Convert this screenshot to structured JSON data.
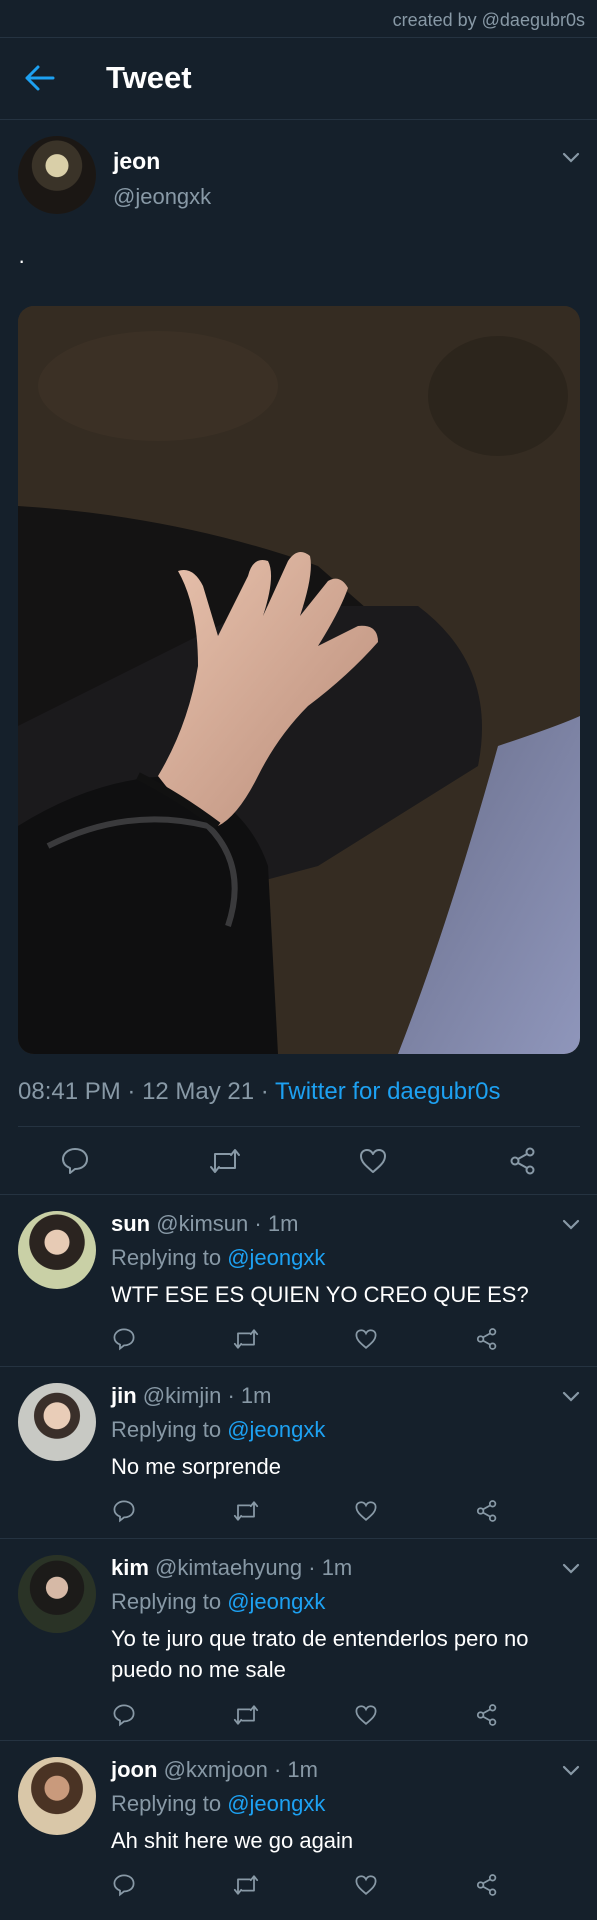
{
  "credit": "created by @daegubr0s",
  "header": {
    "title": "Tweet"
  },
  "tweet": {
    "name": "jeon",
    "handle": "@jeongxk",
    "text": "·",
    "time": "08:41 PM",
    "date": "12 May 21",
    "source": "Twitter for daegubr0s",
    "separator": " · "
  },
  "replies": [
    {
      "name": "sun",
      "handle": "@kimsun",
      "age": "· 1m",
      "replying_label": "Replying to",
      "replying_to": "@jeongxk",
      "text": "WTF ESE ES QUIEN YO CREO QUE ES?"
    },
    {
      "name": "jin",
      "handle": "@kimjin",
      "age": "· 1m",
      "replying_label": "Replying to",
      "replying_to": "@jeongxk",
      "text": "No me sorprende"
    },
    {
      "name": "kim",
      "handle": "@kimtaehyung",
      "age": "· 1m",
      "replying_label": "Replying to",
      "replying_to": "@jeongxk",
      "text": "Yo te juro que trato de entenderlos pero no puedo no me sale"
    },
    {
      "name": "joon",
      "handle": "@kxmjoon",
      "age": "· 1m",
      "replying_label": "Replying to",
      "replying_to": "@jeongxk",
      "text": "Ah shit here we go again"
    }
  ],
  "colors": {
    "background": "#15202b",
    "accent": "#1da1f2",
    "secondary_text": "#8899a6",
    "divider": "#253341"
  },
  "icons": [
    "back-arrow-icon",
    "chevron-down-icon",
    "reply-icon",
    "retweet-icon",
    "like-icon",
    "share-icon"
  ]
}
